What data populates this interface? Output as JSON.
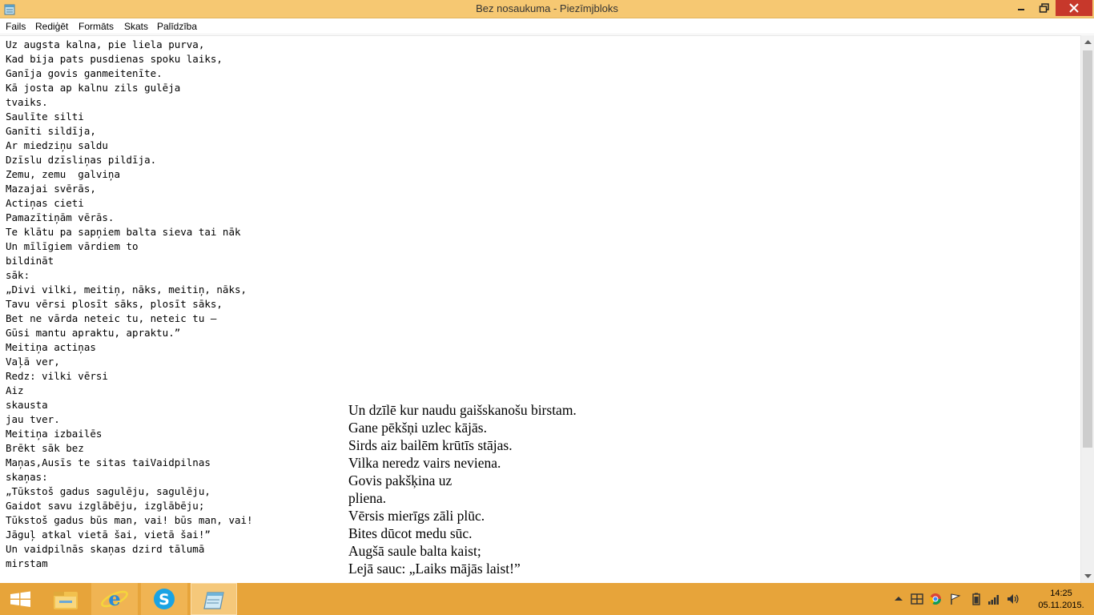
{
  "window": {
    "title": "Bez nosaukuma - Piezīmjbloks"
  },
  "menu": {
    "items": [
      "Fails",
      "Rediģēt",
      "Formāts",
      "Skats",
      "Palīdzība"
    ]
  },
  "editor": {
    "lines": [
      "Uz augsta kalna, pie liela purva,",
      "Kad bija pats pusdienas spoku laiks,",
      "Ganīja govis ganmeitenīte.",
      "Kā josta ap kalnu zils gulēja",
      "tvaiks.",
      "Saulīte silti",
      "Ganīti sildīja,",
      "Ar miedziņu saldu",
      "Dzīslu dzīsliņas pildīja.",
      "Zemu, zemu  galviņa",
      "Mazajai svērās,",
      "Actiņas cieti",
      "Pamazītiņām vērās.",
      "Te klātu pa sapņiem balta sieva tai nāk",
      "Un mīlīgiem vārdiem to",
      "bildināt",
      "sāk:",
      "„Divi vilki, meitiņ, nāks, meitiņ, nāks,",
      "Tavu vērsi plosīt sāks, plosīt sāks,",
      "Bet ne vārda neteic tu, neteic tu –",
      "Gūsi mantu apraktu, apraktu.”",
      "Meitiņa actiņas",
      "Vaļā ver,",
      "Redz: vilki vērsi",
      "Aiz",
      "skausta",
      "jau tver.",
      "Meitiņa izbailēs",
      "Brēkt sāk bez",
      "Maņas,Ausīs te sitas taiVaidpilnas",
      "skaņas:",
      "„Tūkstoš gadus sagulēju, sagulēju,",
      "Gaidot savu izglābēju, izglābēju;",
      "Tūkstoš gadus būs man, vai! būs man, vai!",
      "Jāguļ atkal vietā šai, vietā šai!”",
      "Un vaidpilnās skaņas dzird tālumā",
      "mirstam"
    ],
    "overlay_lines": [
      "Un dzīlē kur naudu gaišskanošu birstam.",
      "Gane pēkšņi uzlec kājās.",
      "Sirds aiz bailēm krūtīs stājas.",
      "Vilka neredz vairs neviena.",
      "Govis pakšķina uz",
      "pliena.",
      "Vērsis mierīgs zāli plūc.",
      "Bites dūcot medu sūc.",
      "Augšā saule balta kaist;",
      "Lejā sauc: „Laiks mājās laist!”"
    ]
  },
  "taskbar": {
    "apps": [
      "windows-start-icon",
      "file-explorer-icon",
      "internet-explorer-icon",
      "skype-icon",
      "notepad-icon"
    ],
    "tray": [
      "chevron-up-icon",
      "windows-icon",
      "chrome-icon",
      "flag-icon",
      "battery-icon",
      "signal-icon",
      "volume-icon"
    ],
    "clock": {
      "time": "14:25",
      "date": "05.11.2015."
    }
  }
}
